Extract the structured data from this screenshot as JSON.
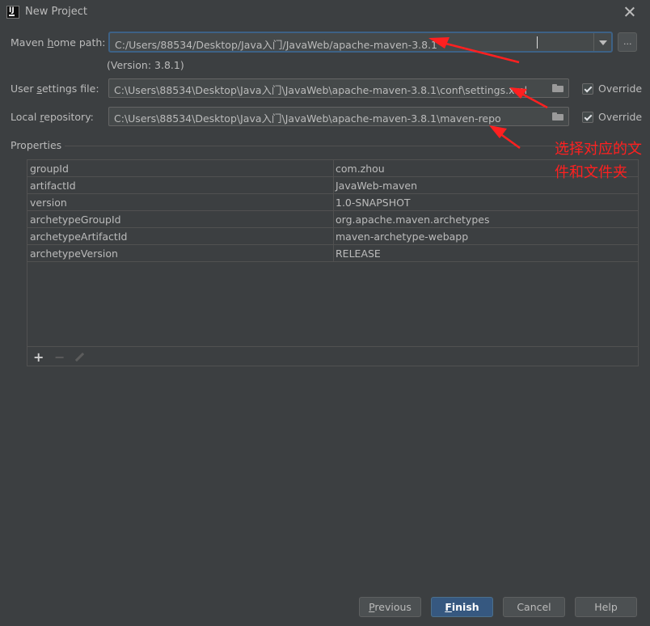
{
  "window": {
    "title": "New Project"
  },
  "maven_home": {
    "label": "Maven home path:",
    "label_u": "h",
    "label_pre": "Maven ",
    "label_post": "ome path:",
    "value": "C:/Users/88534/Desktop/Java入门/JavaWeb/apache-maven-3.8.1",
    "version": "(Version: 3.8.1)",
    "browse_label": "..."
  },
  "user_settings": {
    "label_pre": "User ",
    "label_u": "s",
    "label_post": "ettings file:",
    "value": "C:\\Users\\88534\\Desktop\\Java入门\\JavaWeb\\apache-maven-3.8.1\\conf\\settings.xml",
    "override_label": "Override",
    "override_checked": true
  },
  "local_repo": {
    "label_pre": "Local ",
    "label_u": "r",
    "label_post": "epository:",
    "value": "C:\\Users\\88534\\Desktop\\Java入门\\JavaWeb\\apache-maven-3.8.1\\maven-repo",
    "override_label": "Override",
    "override_checked": true
  },
  "properties": {
    "title": "Properties",
    "rows": [
      {
        "key": "groupId",
        "value": "com.zhou"
      },
      {
        "key": "artifactId",
        "value": "JavaWeb-maven"
      },
      {
        "key": "version",
        "value": "1.0-SNAPSHOT"
      },
      {
        "key": "archetypeGroupId",
        "value": "org.apache.maven.archetypes"
      },
      {
        "key": "archetypeArtifactId",
        "value": "maven-archetype-webapp"
      },
      {
        "key": "archetypeVersion",
        "value": "RELEASE"
      }
    ],
    "add_label": "+",
    "remove_label": "−"
  },
  "buttons": {
    "previous_u": "P",
    "previous_rest": "revious",
    "finish_u": "F",
    "finish_rest": "inish",
    "cancel": "Cancel",
    "help": "Help"
  },
  "annotation": {
    "text": "选择对应的文件和文件夹",
    "color": "#ff2020"
  },
  "colors": {
    "background": "#3c3f41",
    "focus_border": "#3d6185",
    "default_button": "#365880"
  }
}
